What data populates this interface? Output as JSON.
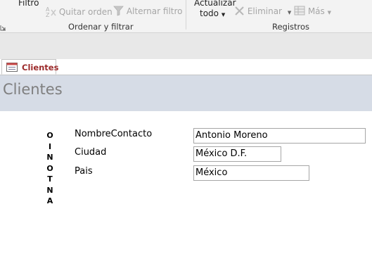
{
  "ribbon": {
    "filter_label": "Filtro",
    "clear_sort_label": "Quitar orden",
    "toggle_filter_label": "Alternar filtro",
    "sort_filter_group": "Ordenar y filtrar",
    "refresh_line1": "Actualizar",
    "refresh_line2": "todo",
    "delete_label": "Eliminar",
    "more_label": "Más",
    "records_group": "Registros"
  },
  "tab": {
    "label": "Clientes"
  },
  "form": {
    "title": "Clientes",
    "vertical_letters": [
      "O",
      "I",
      "N",
      "O",
      "T",
      "N",
      "A"
    ],
    "fields": [
      {
        "label": "NombreContacto",
        "value": "Antonio Moreno"
      },
      {
        "label": "Ciudad",
        "value": "México D.F."
      },
      {
        "label": "Pais",
        "value": "México"
      }
    ]
  }
}
